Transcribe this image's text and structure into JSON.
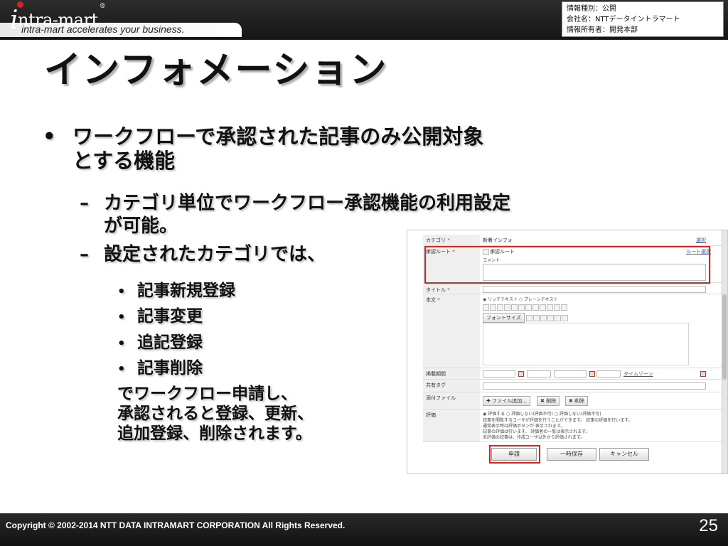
{
  "header": {
    "logo_text": "ntra-mart",
    "tagline": "intra-mart accelerates your business.",
    "info_lines": [
      "情報種別：公開",
      "会社名：NTTデータイントラマート",
      "情報所有者：開発本部"
    ]
  },
  "slide": {
    "title": "インフォメーション",
    "bullet1": {
      "marker": "•",
      "line1": "ワークフローで承認された記事のみ公開対象",
      "line2": "とする機能"
    },
    "sub1": {
      "marker": "–",
      "line1": "カテゴリ単位でワークフロー承認機能の利用設定",
      "line2": "が可能。"
    },
    "sub2": {
      "marker": "–",
      "line1": "設定されたカテゴリでは、"
    },
    "sub_items": [
      "記事新規登録",
      "記事変更",
      "追記登録",
      "記事削除"
    ],
    "sub_item_marker": "•",
    "note_lines": [
      "でワークフロー申請し、",
      "承認されると登録、更新、",
      "追加登録、削除されます。"
    ]
  },
  "screenshot": {
    "category_label": "カテゴリ",
    "category_value": "新着インフォ",
    "category_link": "選択",
    "workflow_label": "承認ルート",
    "workflow_value": "承認ルート",
    "workflow_link": "ルート選択",
    "comment_placeholder": "コメント",
    "title_label": "タイトル",
    "body_label": "本文",
    "richtext_label": "リッチテキスト",
    "plaintext_label": "プレーンテキスト",
    "font_label": "フォントサイズ",
    "period_label": "掲載期間",
    "timezone_link": "タイムゾーン",
    "tag_label": "共有タグ",
    "attach_label": "添付ファイル",
    "attach_add": "ファイル追加...",
    "attach_delete": "削除",
    "attach_clear": "削除",
    "eval_label": "評価",
    "eval_lines": [
      "◉ 評価する  ○ 評価しない(評価不可)  ○ 評価しない(評価不可)",
      "記事を閲覧するユーザが評価を行うことができます。 記事の評価を行います。",
      "通常表示時は評価ボタンが 表示されます。",
      "記事の評価は行います。 評価者の一覧は表示されます。",
      "未評価の記事は、作成ユーザ以外から評価されます。"
    ],
    "apply_button": "申請",
    "save_button": "一時保存",
    "cancel_button": "キャンセル"
  },
  "footer": {
    "copyright": "Copyright © 2002-2014 NTT DATA INTRAMART CORPORATION All Rights Reserved.",
    "page_number": "25"
  }
}
